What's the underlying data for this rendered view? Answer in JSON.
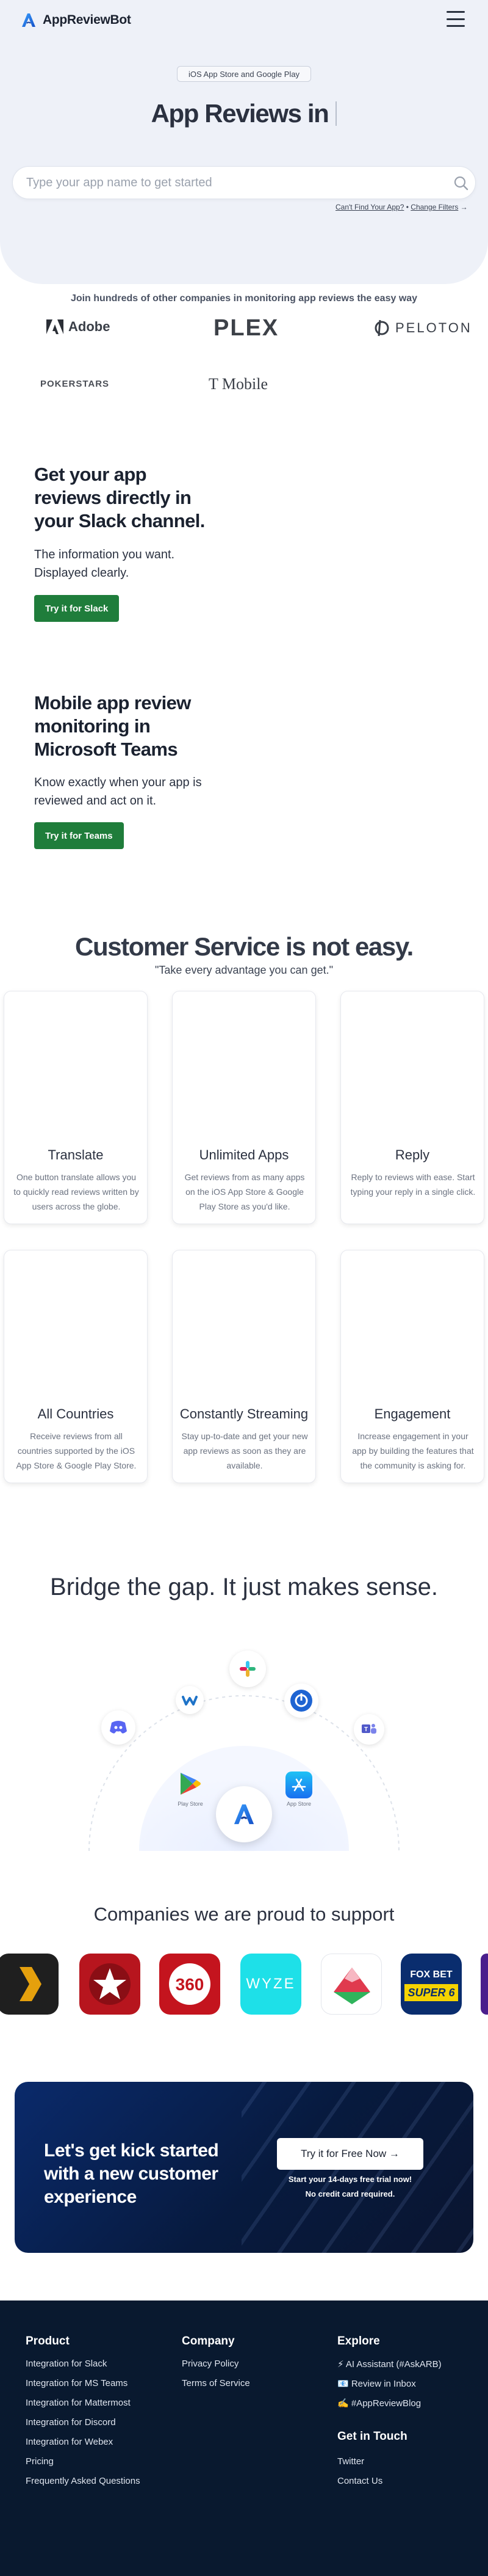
{
  "header": {
    "brand": "AppReviewBot"
  },
  "hero": {
    "badge": "iOS App Store and Google Play",
    "title": "App Reviews in",
    "search_placeholder": "Type your app name to get started",
    "link_cant_find": "Can't Find Your App?",
    "link_separator": "•",
    "link_change_filters": "Change Filters",
    "link_arrow": "→"
  },
  "trusted": {
    "text": "Join hundreds of other companies in monitoring app reviews the easy way",
    "brands": [
      "Adobe",
      "PLEX",
      "PELOTON",
      "POKERSTARS",
      "T Mobile"
    ]
  },
  "slack": {
    "title": "Get your app reviews directly in your Slack channel.",
    "subtitle": "The information you want. Displayed clearly.",
    "button": "Try it for Slack"
  },
  "teams": {
    "title": "Mobile app review monitoring in Microsoft Teams",
    "subtitle": "Know exactly when your app is reviewed and act on it.",
    "button": "Try it for Teams"
  },
  "customer_service": {
    "title": "Customer Service is not easy.",
    "subtitle": "\"Take every advantage you can get.\"",
    "cards": [
      {
        "title": "Translate",
        "text": "One button translate allows you to quickly read reviews written by users across the globe."
      },
      {
        "title": "Unlimited Apps",
        "text": "Get reviews from as many apps on the iOS App Store & Google Play Store as you'd like."
      },
      {
        "title": "Reply",
        "text": "Reply to reviews with ease. Start typing your reply in a single click."
      },
      {
        "title": "All Countries",
        "text": "Receive reviews from all countries supported by the iOS App Store & Google Play Store."
      },
      {
        "title": "Constantly Streaming",
        "text": "Stay up-to-date and get your new app reviews as soon as they are available."
      },
      {
        "title": "Engagement",
        "text": "Increase engagement in your app by building the features that the community is asking for."
      }
    ]
  },
  "bridge": {
    "title": "Bridge the gap. It just makes sense.",
    "play_store_label": "Play Store",
    "app_store_label": "App Store",
    "icons": [
      "discord-icon",
      "webex-icon",
      "slack-icon",
      "mattermost-icon",
      "teams-icon",
      "play-store-icon",
      "appreviewbot-icon",
      "app-store-icon"
    ]
  },
  "companies": {
    "title": "Companies we are proud to support",
    "apps": [
      {
        "name": "plex-app-icon",
        "color": "#1f1f1f"
      },
      {
        "name": "pokerstars-app-icon",
        "color": "#b7151e"
      },
      {
        "name": "life360-app-icon",
        "color": "#c4141e"
      },
      {
        "name": "wyze-app-icon",
        "label": "WYZE",
        "color": "#1ee0e8"
      },
      {
        "name": "mountain-app-icon",
        "color": "#ffffff"
      },
      {
        "name": "fox-bet-app-icon",
        "label1": "FOX BET",
        "label2": "SUPER 6",
        "color": "#0a2d6e"
      },
      {
        "name": "purple-app-icon",
        "color": "#4a1e8c"
      }
    ]
  },
  "cta": {
    "title": "Let's get kick started with a new customer experience",
    "button": "Try it for Free Now →",
    "note1": "Start your 14-days free trial now!",
    "note2": "No credit card required."
  },
  "footer": {
    "product": {
      "heading": "Product",
      "links": [
        "Integration for Slack",
        "Integration for MS Teams",
        "Integration for Mattermost",
        "Integration for Discord",
        "Integration for Webex",
        "Pricing",
        "Frequently Asked Questions"
      ]
    },
    "company": {
      "heading": "Company",
      "links": [
        "Privacy Policy",
        "Terms of Service"
      ]
    },
    "explore": {
      "heading": "Explore",
      "links": [
        "⚡ AI Assistant (#AskARB)",
        "📧 Review in Inbox",
        "✍️ #AppReviewBlog"
      ]
    },
    "touch": {
      "heading": "Get in Touch",
      "links": [
        "Twitter",
        "Contact Us"
      ]
    }
  },
  "colors": {
    "accent_green": "#1f7d3b",
    "hero_bg": "#eef1f8",
    "footer_bg": "#09192f",
    "brand_blue": "#1a73e8"
  }
}
